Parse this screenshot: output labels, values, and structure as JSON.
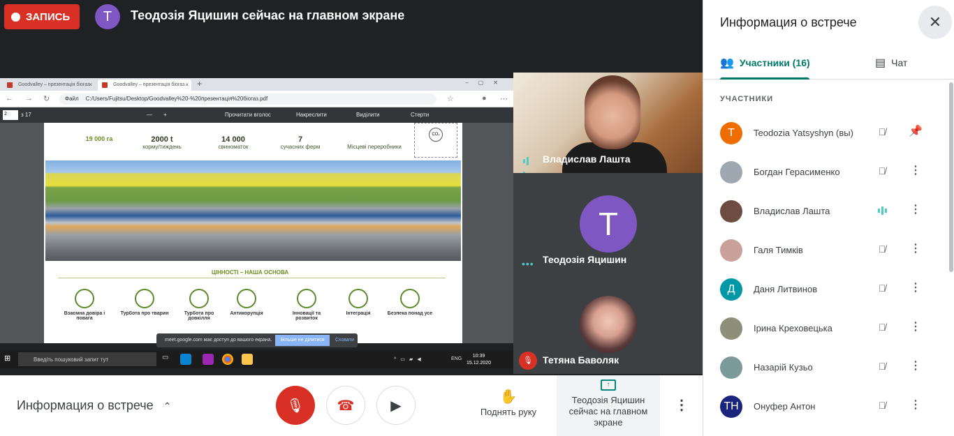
{
  "top": {
    "record_label": "ЗАПИСЬ",
    "presenter_initial": "T",
    "presenter_text": "Теодозія Яцишин сейчас на главном экране"
  },
  "shared_screen": {
    "tabs": [
      "Goodvalley – презентація біогаз",
      "Goodvalley – презентація біогаз"
    ],
    "file_label": "Файл",
    "url": "C:/Users/Fujitsu/Desktop/Goodvalley%20-%20презентація%20біогаз.pdf",
    "page_indicator": "2",
    "page_total": "з 17",
    "pdf_tools": [
      "Прочитати вголос",
      "Накреслити",
      "Виділити",
      "Стерти"
    ],
    "stats": [
      {
        "value": "19 000",
        "unit": "га",
        "label": ""
      },
      {
        "value": "2000 t",
        "unit": "",
        "label": "корму/тиждень"
      },
      {
        "value": "14 000",
        "unit": "",
        "label": "свиноматок"
      },
      {
        "value": "7",
        "unit": "",
        "label": "сучасних ферм"
      },
      {
        "value": "",
        "unit": "",
        "label": "Місцеві переробники"
      }
    ],
    "co2_label": "CO₂",
    "values_title": "ЦІННОСТІ – НАША ОСНОВА",
    "values": [
      "Взаємна довіра і повага",
      "Турбота про тварин",
      "Турбота про довкілля",
      "Антикорупція",
      "Інновації та розвиток",
      "Інтеграція",
      "Безпека понад усе"
    ],
    "notification": {
      "text": "meet.google.com має доступ до вашого екрана.",
      "stop_button": "Більше не ділитися",
      "hide_button": "Сховати"
    },
    "taskbar": {
      "search_placeholder": "Введіть пошуковий запит тут",
      "lang": "ENG",
      "time": "10:39",
      "date": "15.12.2020"
    }
  },
  "tiles": [
    {
      "name": "Владислав Лашта",
      "speaking": true
    },
    {
      "name": "Теодозія Яцишин",
      "initial": "T"
    },
    {
      "name": "Тетяна Баволяк",
      "muted": true
    }
  ],
  "bottom": {
    "meeting_info": "Информация о встрече",
    "raise_hand": "Поднять руку",
    "present_label": "Теодозія Яцишин сейчас на главном экране"
  },
  "side": {
    "title": "Информация о встрече",
    "tab_people": "Участники (16)",
    "tab_chat": "Чат",
    "section_label": "УЧАСТНИКИ",
    "participants": [
      {
        "name": "Teodozia Yatsyshyn (вы)",
        "initial": "T",
        "color": "#ef6c00",
        "speaking": false,
        "action": "pin"
      },
      {
        "name": "Богдан Герасименко",
        "initial": "",
        "color": "#9fa8b0",
        "speaking": false,
        "action": "more"
      },
      {
        "name": "Владислав Лашта",
        "initial": "",
        "color": "#6d4c41",
        "speaking": true,
        "action": "more"
      },
      {
        "name": "Галя Тимків",
        "initial": "",
        "color": "#c9a09a",
        "speaking": false,
        "action": "more"
      },
      {
        "name": "Даня Литвинов",
        "initial": "Д",
        "color": "#0097a7",
        "speaking": false,
        "action": "more"
      },
      {
        "name": "Ірина Креховецька",
        "initial": "",
        "color": "#8d8f7a",
        "speaking": false,
        "action": "more"
      },
      {
        "name": "Назарій Кузьо",
        "initial": "",
        "color": "#7d9a9a",
        "speaking": false,
        "action": "more"
      },
      {
        "name": "Онуфер Антон",
        "initial": "TH",
        "color": "#1a237e",
        "speaking": false,
        "action": "more"
      }
    ]
  },
  "colors": {
    "accent": "#00796b",
    "record": "#d93025",
    "speaking": "#4ecdc4"
  }
}
